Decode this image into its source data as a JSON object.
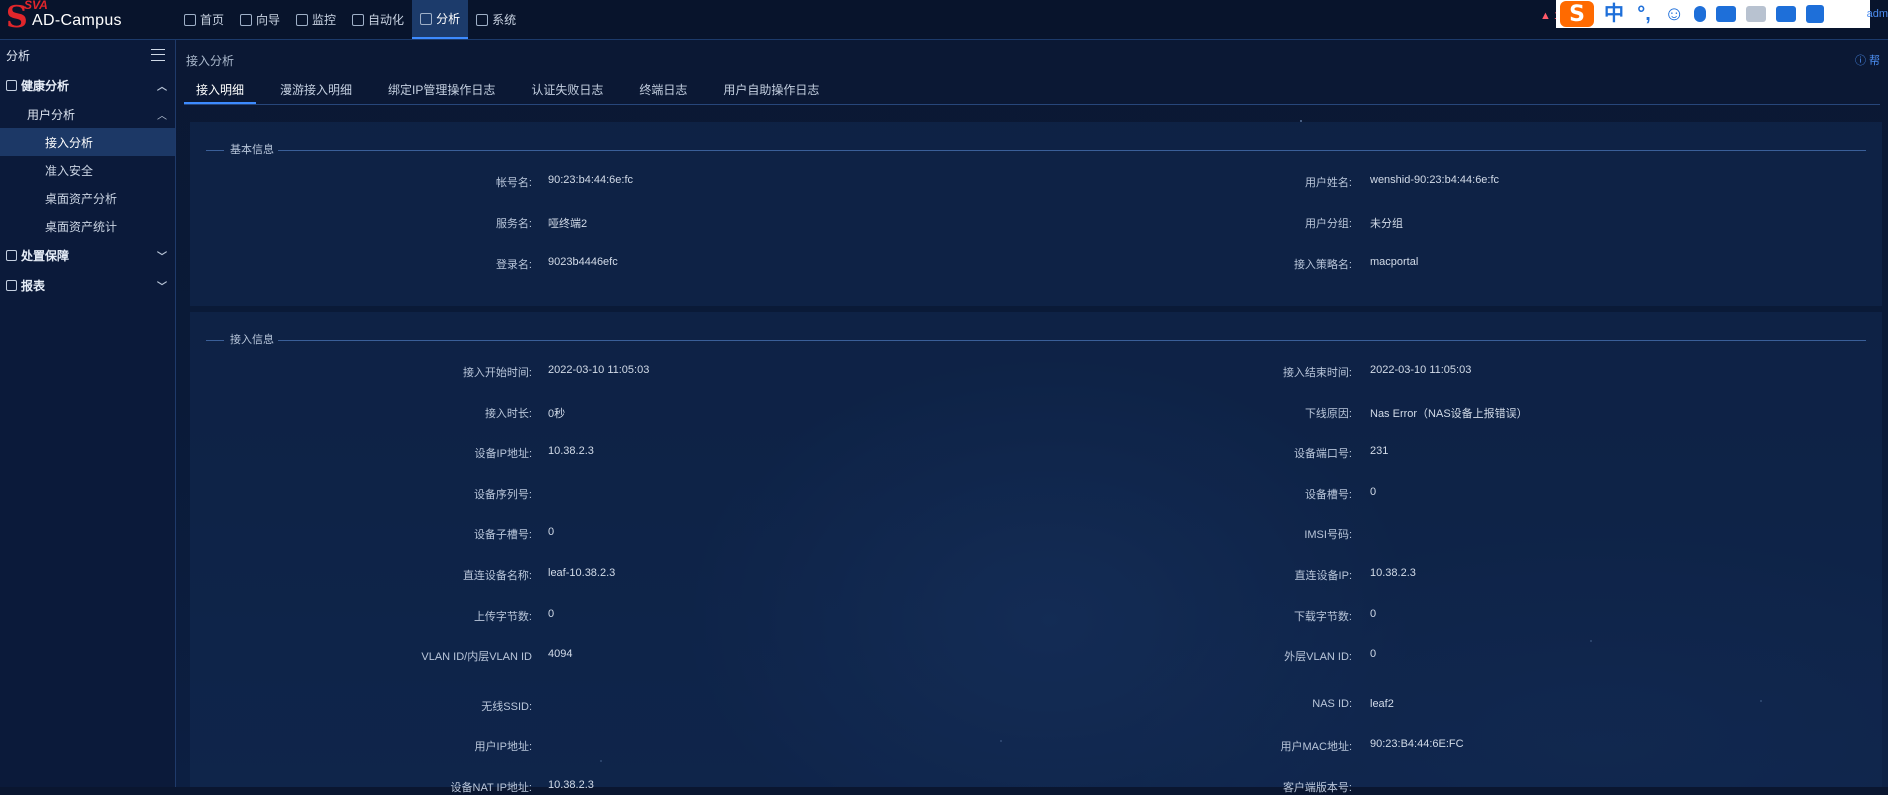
{
  "app": {
    "logo_top": "SVA",
    "logo_mark": "S",
    "logo_text": "AD-Campus"
  },
  "nav": [
    {
      "label": "首页",
      "icon": "home-icon"
    },
    {
      "label": "向导",
      "icon": "guide-icon"
    },
    {
      "label": "监控",
      "icon": "monitor-icon"
    },
    {
      "label": "自动化",
      "icon": "automation-icon"
    },
    {
      "label": "分析",
      "icon": "analysis-icon",
      "active": true
    },
    {
      "label": "系统",
      "icon": "system-icon"
    }
  ],
  "header_right": {
    "alert": "▲ 1",
    "admin": "adm"
  },
  "ime_toolbar": {
    "logo": "S",
    "lang": "中",
    "punct": "°,",
    "emoji": "☺"
  },
  "sidebar": {
    "title": "分析",
    "groups": [
      {
        "label": "健康分析",
        "expanded": true,
        "subgroups": [
          {
            "label": "用户分析",
            "expanded": true,
            "items": [
              {
                "label": "接入分析",
                "active": true
              },
              {
                "label": "准入安全"
              },
              {
                "label": "桌面资产分析"
              },
              {
                "label": "桌面资产统计"
              }
            ]
          }
        ]
      },
      {
        "label": "处置保障",
        "expanded": false
      },
      {
        "label": "报表",
        "expanded": false
      }
    ]
  },
  "page": {
    "breadcrumb": "接入分析",
    "help": "帮",
    "tabs": [
      {
        "label": "接入明细",
        "active": true
      },
      {
        "label": "漫游接入明细"
      },
      {
        "label": "绑定IP管理操作日志"
      },
      {
        "label": "认证失败日志"
      },
      {
        "label": "终端日志"
      },
      {
        "label": "用户自助操作日志"
      }
    ]
  },
  "basic_info": {
    "title": "基本信息",
    "rows": [
      {
        "l_label": "帐号名:",
        "l_value": "90:23:b4:44:6e:fc",
        "r_label": "用户姓名:",
        "r_value": "wenshid-90:23:b4:44:6e:fc"
      },
      {
        "l_label": "服务名:",
        "l_value": "哑终端2",
        "r_label": "用户分组:",
        "r_value": "未分组"
      },
      {
        "l_label": "登录名:",
        "l_value": "9023b4446efc",
        "r_label": "接入策略名:",
        "r_value": "macportal"
      }
    ]
  },
  "access_info": {
    "title": "接入信息",
    "rows": [
      {
        "l_label": "接入开始时间:",
        "l_value": "2022-03-10 11:05:03",
        "r_label": "接入结束时间:",
        "r_value": "2022-03-10 11:05:03"
      },
      {
        "l_label": "接入时长:",
        "l_value": "0秒",
        "r_label": "下线原因:",
        "r_value": "Nas Error（NAS设备上报错误）"
      },
      {
        "l_label": "设备IP地址:",
        "l_value": "10.38.2.3",
        "r_label": "设备端口号:",
        "r_value": "231"
      },
      {
        "l_label": "设备序列号:",
        "l_value": "",
        "r_label": "设备槽号:",
        "r_value": "0"
      },
      {
        "l_label": "设备子槽号:",
        "l_value": "0",
        "r_label": "IMSI号码:",
        "r_value": ""
      },
      {
        "l_label": "直连设备名称:",
        "l_value": "leaf-10.38.2.3",
        "r_label": "直连设备IP:",
        "r_value": "10.38.2.3"
      },
      {
        "l_label": "上传字节数:",
        "l_value": "0",
        "r_label": "下载字节数:",
        "r_value": "0"
      },
      {
        "l_label": "VLAN ID/内层VLAN ID",
        "l_value": "4094",
        "r_label": "外层VLAN ID:",
        "r_value": "0"
      },
      {
        "l_label": "无线SSID:",
        "l_value": "",
        "r_label": "NAS ID:",
        "r_value": "leaf2"
      },
      {
        "l_label": "用户IP地址:",
        "l_value": "",
        "r_label": "用户MAC地址:",
        "r_value": "90:23:B4:44:6E:FC"
      },
      {
        "l_label": "设备NAT IP地址:",
        "l_value": "10.38.2.3",
        "r_label": "客户端版本号:",
        "r_value": ""
      }
    ]
  }
}
